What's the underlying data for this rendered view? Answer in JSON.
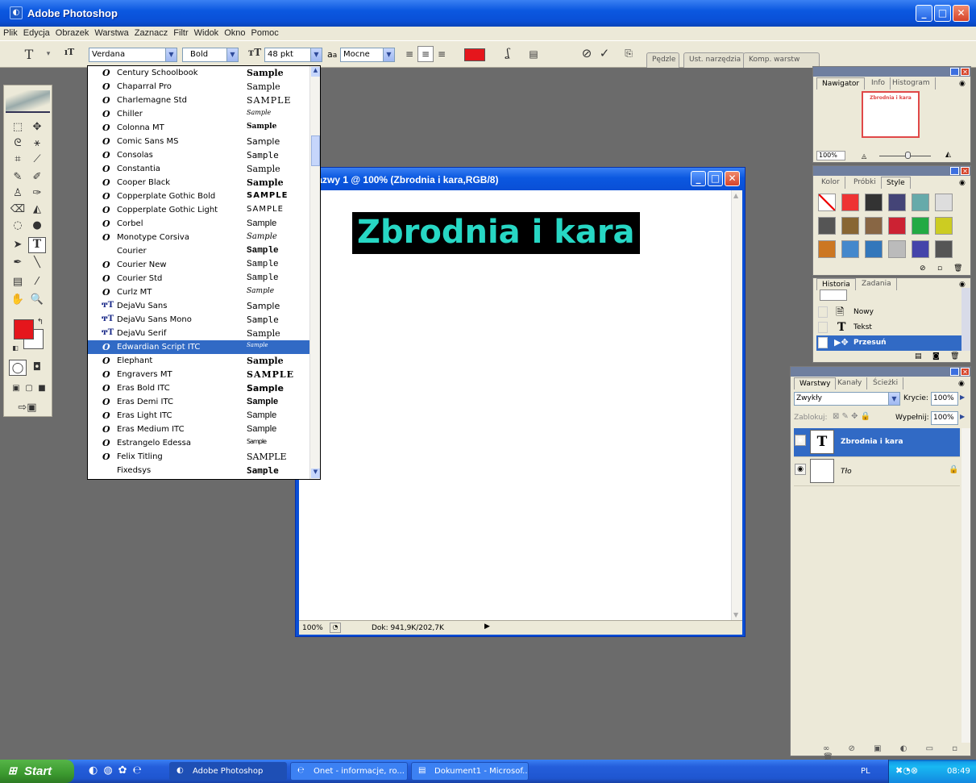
{
  "app": {
    "title": "Adobe Photoshop"
  },
  "menubar": [
    "Plik",
    "Edycja",
    "Obrazek",
    "Warstwa",
    "Zaznacz",
    "Filtr",
    "Widok",
    "Okno",
    "Pomoc"
  ],
  "options": {
    "font_family": "Verdana",
    "font_style": "Bold",
    "font_size": "48 pkt",
    "aa_label": "a",
    "aa_mode": "Mocne",
    "color": "#e5161c",
    "wells": [
      "Pędzle",
      "Ust. narzędzia",
      "Komp. warstw"
    ]
  },
  "fonts": [
    {
      "name": "Century Schoolbook",
      "sample": "Sample",
      "type": "o"
    },
    {
      "name": "Chaparral Pro",
      "sample": "Sample",
      "type": "o"
    },
    {
      "name": "Charlemagne Std",
      "sample": "SAMPLE",
      "type": "o"
    },
    {
      "name": "Chiller",
      "sample": "Sample",
      "type": "o"
    },
    {
      "name": "Colonna MT",
      "sample": "Sample",
      "type": "o"
    },
    {
      "name": "Comic Sans MS",
      "sample": "Sample",
      "type": "o"
    },
    {
      "name": "Consolas",
      "sample": "Sample",
      "type": "o"
    },
    {
      "name": "Constantia",
      "sample": "Sample",
      "type": "o"
    },
    {
      "name": "Cooper Black",
      "sample": "Sample",
      "type": "o"
    },
    {
      "name": "Copperplate Gothic Bold",
      "sample": "SAMPLE",
      "type": "o"
    },
    {
      "name": "Copperplate Gothic Light",
      "sample": "SAMPLE",
      "type": "o"
    },
    {
      "name": "Corbel",
      "sample": "Sample",
      "type": "o"
    },
    {
      "name": "Monotype Corsiva",
      "sample": "Sample",
      "type": "o"
    },
    {
      "name": "Courier",
      "sample": "Sample",
      "type": "none"
    },
    {
      "name": "Courier New",
      "sample": "Sample",
      "type": "o"
    },
    {
      "name": "Courier Std",
      "sample": "Sample",
      "type": "o"
    },
    {
      "name": "Curlz MT",
      "sample": "Sample",
      "type": "o"
    },
    {
      "name": "DejaVu Sans",
      "sample": "Sample",
      "type": "tt"
    },
    {
      "name": "DejaVu Sans Mono",
      "sample": "Sample",
      "type": "tt"
    },
    {
      "name": "DejaVu Serif",
      "sample": "Sample",
      "type": "tt"
    },
    {
      "name": "Edwardian Script ITC",
      "sample": "Sample",
      "type": "o"
    },
    {
      "name": "Elephant",
      "sample": "Sample",
      "type": "o"
    },
    {
      "name": "Engravers MT",
      "sample": "SAMPLE",
      "type": "o"
    },
    {
      "name": "Eras Bold ITC",
      "sample": "Sample",
      "type": "o"
    },
    {
      "name": "Eras Demi ITC",
      "sample": "Sample",
      "type": "o"
    },
    {
      "name": "Eras Light ITC",
      "sample": "Sample",
      "type": "o"
    },
    {
      "name": "Eras Medium ITC",
      "sample": "Sample",
      "type": "o"
    },
    {
      "name": "Estrangelo Edessa",
      "sample": "Sample",
      "type": "o"
    },
    {
      "name": "Felix Titling",
      "sample": "SAMPLE",
      "type": "o"
    },
    {
      "name": "Fixedsys",
      "sample": "Sample",
      "type": "none"
    }
  ],
  "selected_font": "Edwardian Script ITC",
  "document": {
    "title": "ez nazwy 1 @ 100% (Zbrodnia i kara,RGB/8)",
    "text": "Zbrodnia i kara",
    "zoom": "100%",
    "doc_info": "Dok: 941,9K/202,7K"
  },
  "navigator": {
    "tabs": [
      "Nawigator",
      "Info",
      "Histogram"
    ],
    "preview_text": "Zbrodnia i kara",
    "zoom": "100%"
  },
  "styles": {
    "tabs": [
      "Kolor",
      "Próbki",
      "Style"
    ]
  },
  "history": {
    "tabs": [
      "Historia",
      "Zadania"
    ],
    "items": [
      {
        "label": "Nowy",
        "icon": "document-icon"
      },
      {
        "label": "Tekst",
        "icon": "type-icon"
      },
      {
        "label": "Przesuń",
        "icon": "move-icon"
      }
    ]
  },
  "layers": {
    "tabs": [
      "Warstwy",
      "Kanały",
      "Ścieżki"
    ],
    "blend_mode": "Zwykły",
    "opacity_label": "Krycie:",
    "opacity": "100%",
    "lock_label": "Zablokuj:",
    "fill_label": "Wypełnij:",
    "fill": "100%",
    "items": [
      {
        "name": "Zbrodnia i kara",
        "thumb": "T"
      },
      {
        "name": "Tło",
        "thumb": ""
      }
    ]
  },
  "taskbar": {
    "start": "Start",
    "tasks": [
      "Adobe Photoshop",
      "Onet - informacje, ro...",
      "Dokument1 - Microsof..."
    ],
    "lang": "PL",
    "time": "08:49"
  }
}
